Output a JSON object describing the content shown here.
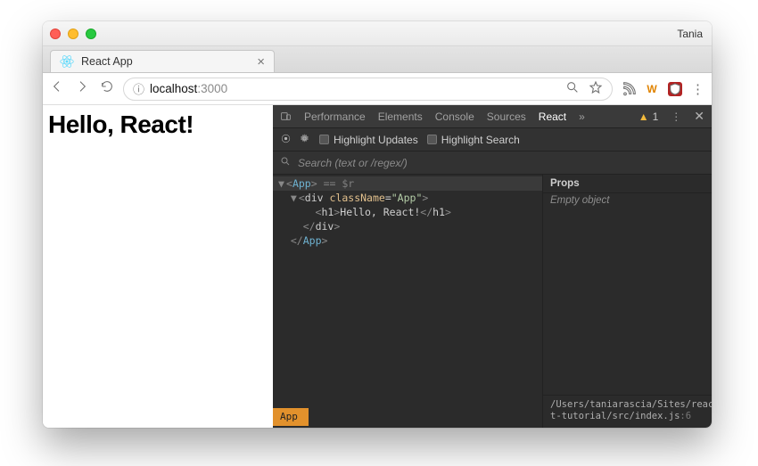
{
  "window": {
    "profile_name": "Tania"
  },
  "tab": {
    "title": "React App",
    "close": "×"
  },
  "omnibox": {
    "info_icon": "ⓘ",
    "host": "localhost",
    "port": ":3000"
  },
  "page": {
    "heading": "Hello, React!"
  },
  "devtools": {
    "tabs": {
      "performance": "Performance",
      "elements": "Elements",
      "console": "Console",
      "sources": "Sources",
      "react": "React",
      "more": "»",
      "warn_count": "1"
    },
    "subbar": {
      "highlight_updates": "Highlight Updates",
      "highlight_search": "Highlight Search"
    },
    "search": {
      "placeholder": "Search (text or /regex/)"
    },
    "tree": {
      "line1_open": "<App>",
      "line1_suf": " == $r",
      "line2_pre": "<div ",
      "line2_attr": "className",
      "line2_eq": "=",
      "line2_val": "\"App\"",
      "line2_close": ">",
      "line3_open": "<h1>",
      "line3_text": "Hello, React!",
      "line3_close": "</h1>",
      "line4": "</div>",
      "line5": "</App>",
      "breadcrumb": "App"
    },
    "side": {
      "props_title": "Props",
      "props_body": "Empty object",
      "path_a": "/Users/taniarascia/Sites/reac",
      "path_b": "t-tutorial/src/index.js",
      "path_line": ":6"
    }
  }
}
